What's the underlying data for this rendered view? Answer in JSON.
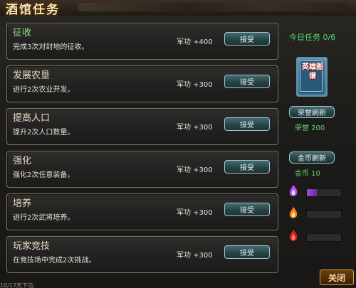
{
  "window": {
    "title": "酒馆任务"
  },
  "tasks": [
    {
      "name": "征收",
      "desc": "完成3次对封地的征收。",
      "merit": "军功 +400",
      "action": "接受"
    },
    {
      "name": "发展农垦",
      "desc": "进行2次农业开发。",
      "merit": "军功 +300",
      "action": "接受"
    },
    {
      "name": "提高人口",
      "desc": "提升2次人口数量。",
      "merit": "军功 +300",
      "action": "接受"
    },
    {
      "name": "强化",
      "desc": "强化2次任意装备。",
      "merit": "军功 +300",
      "action": "接受"
    },
    {
      "name": "培养",
      "desc": "进行2次武将培养。",
      "merit": "军功 +300",
      "action": "接受"
    },
    {
      "name": "玩家竞技",
      "desc": "在竞技场中完成2次挑战。",
      "merit": "军功 +300",
      "action": "接受"
    }
  ],
  "sidebar": {
    "today": "今日任务 0/6",
    "book_label": "英雄图谱",
    "honor_refresh": "荣誉刷新",
    "honor_value": "荣誉 200",
    "gold_refresh": "金币刷新",
    "gold_value": "金币 10",
    "resources": [
      {
        "icon": "purple-flame-icon",
        "color": "#9a4fd6",
        "level": 0.3
      },
      {
        "icon": "orange-flame-icon",
        "color": "#ff9a3a",
        "level": 0
      },
      {
        "icon": "red-flame-icon",
        "color": "#e0201a",
        "level": 0
      }
    ]
  },
  "footer": {
    "close": "关闭",
    "status_text": "10/17天下功"
  },
  "colors": {
    "accent_green": "#55d86b",
    "button_teal": "#274548",
    "panel_border": "#7a7568"
  }
}
